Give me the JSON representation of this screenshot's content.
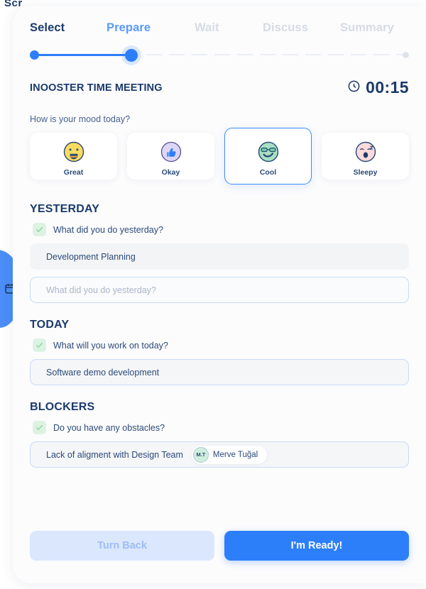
{
  "background": {
    "partial_text_behind_card": "Scr",
    "side_tab_icon": "calendar-icon",
    "accent_blue": "#2d7ff9",
    "navy": "#1b3a6b"
  },
  "stepper": {
    "steps": [
      {
        "label": "Select",
        "state": "done"
      },
      {
        "label": "Prepare",
        "state": "active"
      },
      {
        "label": "Wait",
        "state": "todo"
      },
      {
        "label": "Discuss",
        "state": "todo"
      },
      {
        "label": "Summary",
        "state": "todo"
      }
    ]
  },
  "header": {
    "meeting_title": "INOOSTER TIME MEETING",
    "timer_icon": "clock-icon",
    "timer_value": "00:15"
  },
  "mood": {
    "question": "How is your mood today?",
    "options": [
      {
        "label": "Great",
        "icon": "smiling-face-icon",
        "selected": false
      },
      {
        "label": "Okay",
        "icon": "thumbs-up-icon",
        "selected": false
      },
      {
        "label": "Cool",
        "icon": "sunglasses-face-icon",
        "selected": true
      },
      {
        "label": "Sleepy",
        "icon": "yawning-face-icon",
        "selected": false
      }
    ]
  },
  "sections": {
    "yesterday": {
      "title": "YESTERDAY",
      "question": "What did you do yesterday?",
      "entry": "Development Planning",
      "new_entry_placeholder": "What did you do yesterday?",
      "new_entry_value": ""
    },
    "today": {
      "title": "TODAY",
      "question": "What will you work on today?",
      "entry": "Software demo development"
    },
    "blockers": {
      "title": "BLOCKERS",
      "question": "Do you have any obstacles?",
      "entry": "Lack of aligment with Design Team",
      "person_initials": "M.T",
      "person_name": "Merve Tuğal"
    }
  },
  "footer": {
    "back_label": "Turn Back",
    "ready_label": "I'm Ready!"
  }
}
